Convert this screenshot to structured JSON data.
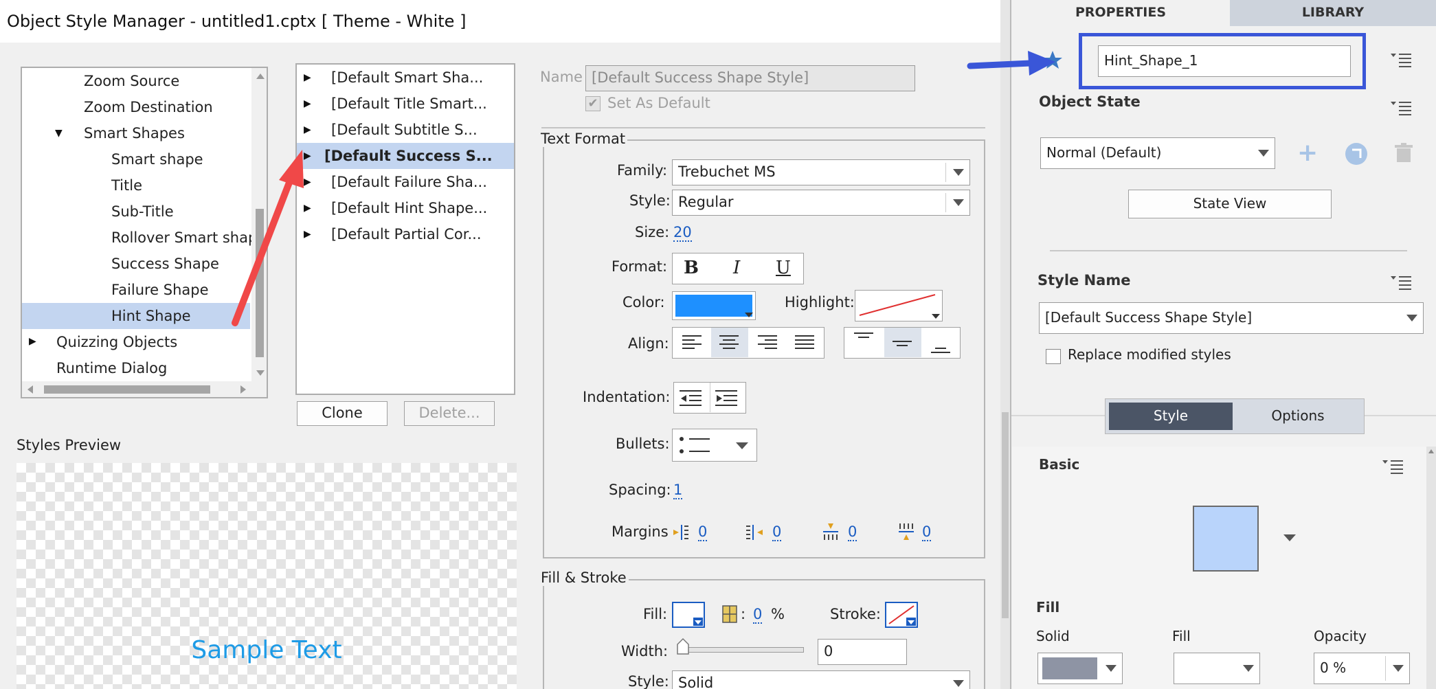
{
  "dialog": {
    "title": "Object Style Manager - untitled1.cptx [ Theme - White ]",
    "tree": {
      "items": [
        {
          "label": "Zoom Source"
        },
        {
          "label": "Zoom Destination"
        },
        {
          "label": "Smart Shapes"
        },
        {
          "label": "Smart shape"
        },
        {
          "label": "Title"
        },
        {
          "label": "Sub-Title"
        },
        {
          "label": "Rollover Smart shap"
        },
        {
          "label": "Success Shape"
        },
        {
          "label": "Failure Shape"
        },
        {
          "label": "Hint Shape"
        },
        {
          "label": "Quizzing Objects"
        },
        {
          "label": "Runtime Dialog"
        }
      ],
      "selected": "Hint Shape"
    },
    "styles_list": {
      "items": [
        {
          "label": "[Default Smart Sha..."
        },
        {
          "label": "[Default Title Smart..."
        },
        {
          "label": "[Default Subtitle S..."
        },
        {
          "label": "[Default Success S..."
        },
        {
          "label": "[Default Failure Sha..."
        },
        {
          "label": "[Default Hint Shape..."
        },
        {
          "label": "[Default Partial Cor..."
        }
      ],
      "selected": "[Default Success S..."
    },
    "clone_label": "Clone",
    "delete_label": "Delete...",
    "preview_label": "Styles Preview",
    "preview_text": "Sample Text",
    "name_label": "Name",
    "name_value": "[Default Success Shape Style]",
    "set_default_label": "Set As Default",
    "text_format": {
      "title": "Text Format",
      "family_label": "Family:",
      "family_value": "Trebuchet MS",
      "style_label": "Style:",
      "style_value": "Regular",
      "size_label": "Size:",
      "size_value": "20",
      "format_label": "Format:",
      "bold": "B",
      "italic": "I",
      "underline": "U",
      "color_label": "Color:",
      "color_value": "#1e90ff",
      "highlight_label": "Highlight:",
      "align_label": "Align:",
      "indentation_label": "Indentation:",
      "bullets_label": "Bullets:",
      "spacing_label": "Spacing:",
      "spacing_value": "1",
      "margins_label": "Margins",
      "margins": [
        "0",
        "0",
        "0",
        "0"
      ]
    },
    "fill_stroke": {
      "title": "Fill & Stroke",
      "fill_label": "Fill:",
      "fill_percent": "0",
      "percent_sign": "%",
      "colon": ":",
      "stroke_label": "Stroke:",
      "width_label": "Width:",
      "width_value": "0",
      "style_label": "Style:",
      "style_value": "Solid"
    }
  },
  "panel": {
    "tab_properties": "PROPERTIES",
    "tab_library": "LIBRARY",
    "object_name": "Hint_Shape_1",
    "object_state_label": "Object State",
    "state_value": "Normal (Default)",
    "state_view_label": "State View",
    "style_name_label": "Style Name",
    "style_name_value": "[Default Success Shape Style]",
    "replace_label": "Replace modified styles",
    "seg_style": "Style",
    "seg_options": "Options",
    "basic_label": "Basic",
    "fill_section": "Fill",
    "solid_label": "Solid",
    "fill_label": "Fill",
    "opacity_label": "Opacity",
    "opacity_value": "0 %"
  },
  "colors": {
    "accent_blue": "#1e90ff",
    "sample_text": "#1e9be6",
    "selection": "#c3d5f0",
    "annotation_red": "#f04848",
    "annotation_blue": "#3a56d8",
    "style_swatch": "#b9d4fb"
  }
}
